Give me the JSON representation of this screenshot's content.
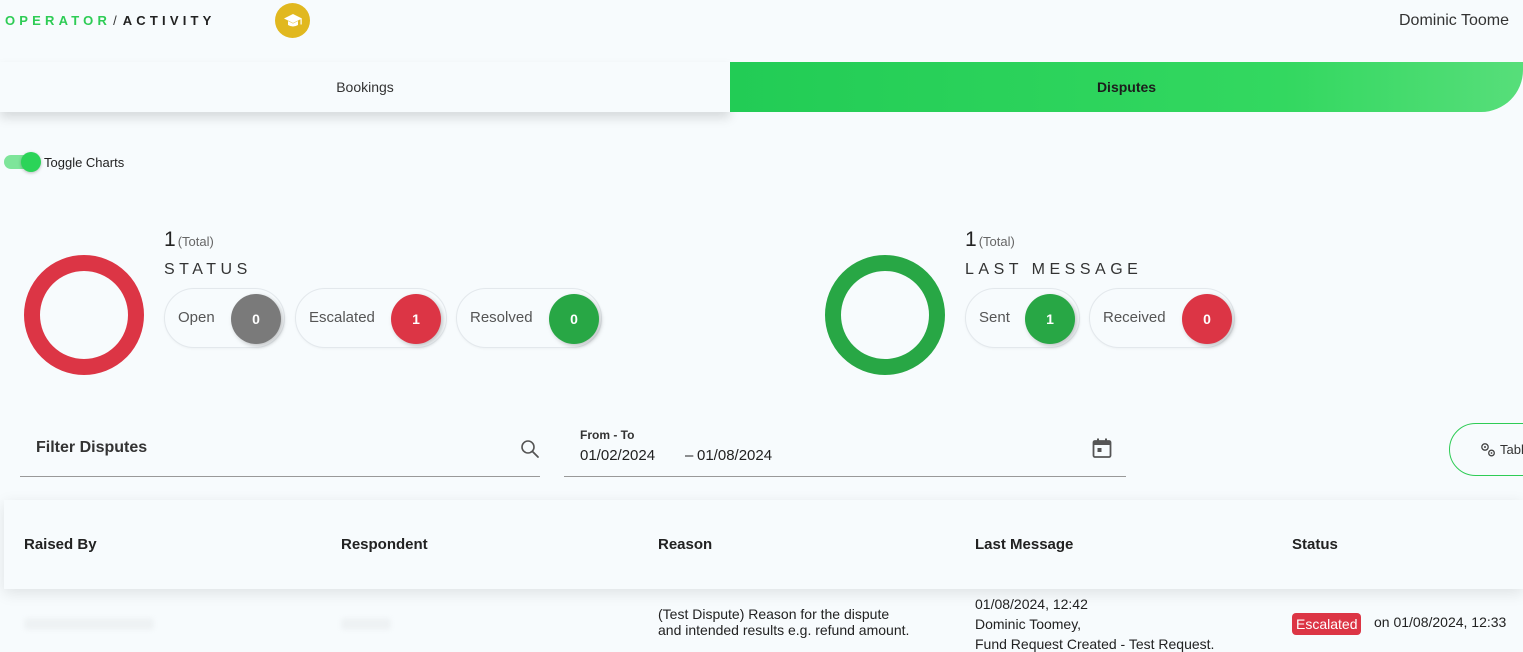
{
  "header": {
    "breadcrumb_primary": "OPERATOR",
    "breadcrumb_separator": "/",
    "breadcrumb_secondary": "ACTIVITY",
    "badge_icon": "graduation-cap-icon",
    "user_name": "Dominic Toome"
  },
  "tabs": [
    {
      "label": "Bookings",
      "active": false
    },
    {
      "label": "Disputes",
      "active": true
    }
  ],
  "toggle": {
    "label": "Toggle Charts",
    "on": true
  },
  "status_panel": {
    "total": "1",
    "total_suffix": "(Total)",
    "title": "STATUS",
    "ring_color": "#dc3545",
    "items": [
      {
        "label": "Open",
        "count": "0",
        "color": "#7a7a7a"
      },
      {
        "label": "Escalated",
        "count": "1",
        "color": "#dc3545"
      },
      {
        "label": "Resolved",
        "count": "0",
        "color": "#28a745"
      }
    ]
  },
  "message_panel": {
    "total": "1",
    "total_suffix": "(Total)",
    "title": "LAST MESSAGE",
    "ring_color": "#28a745",
    "items": [
      {
        "label": "Sent",
        "count": "1",
        "color": "#28a745"
      },
      {
        "label": "Received",
        "count": "0",
        "color": "#dc3545"
      }
    ]
  },
  "filters": {
    "search_placeholder": "Filter Disputes",
    "date_label": "From - To",
    "date_from": "01/02/2024",
    "date_separator": "–",
    "date_to": "01/08/2024",
    "table_button_label": "Table"
  },
  "table": {
    "columns": [
      "Raised By",
      "Respondent",
      "Reason",
      "Last Message",
      "Status"
    ],
    "rows": [
      {
        "reason_line1": "(Test Dispute) Reason for the dispute",
        "reason_line2": "and intended results e.g. refund amount.",
        "message_time": "01/08/2024, 12:42",
        "message_author": "Dominic Toomey,",
        "message_text": "Fund Request Created - Test Request.",
        "status": "Escalated",
        "status_time": "on 01/08/2024, 12:33"
      }
    ]
  },
  "colors": {
    "accent": "#2ecc55",
    "danger": "#dc3545",
    "success": "#28a745",
    "badge": "#e1b81f"
  }
}
